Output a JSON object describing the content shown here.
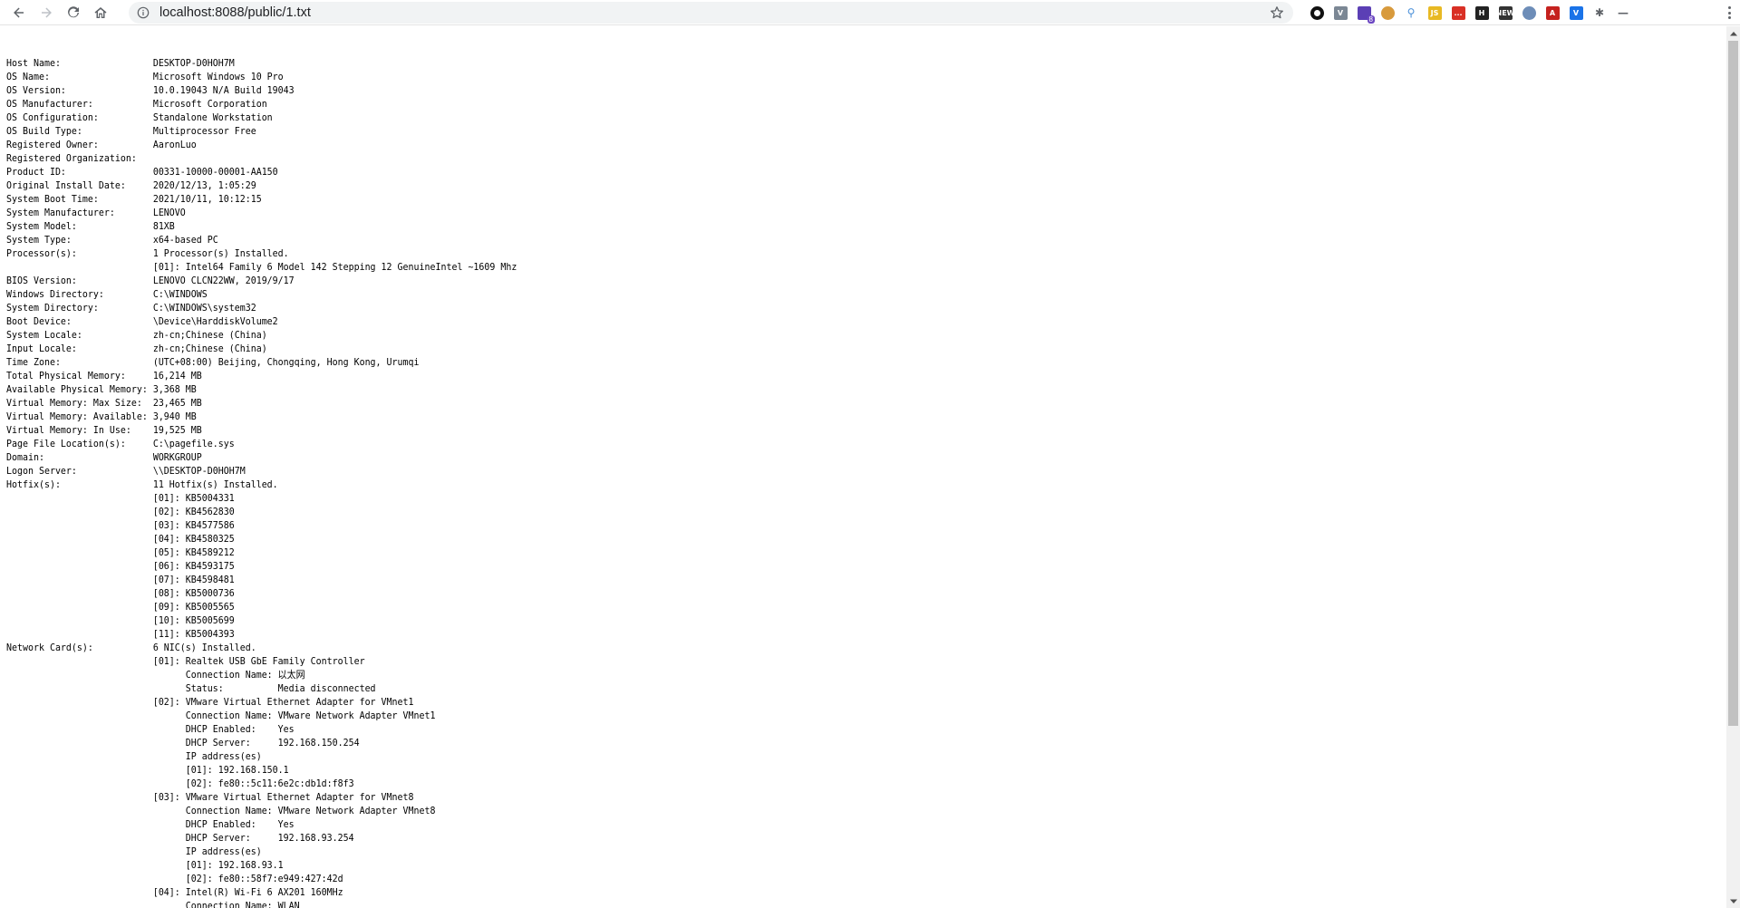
{
  "browser": {
    "url": "localhost:8088/public/1.txt",
    "extensions": [
      {
        "name": "obsidian-icon",
        "color": "#111111",
        "text": ""
      },
      {
        "name": "vue-devtools-icon",
        "color": "#7b8794",
        "text": "V"
      },
      {
        "name": "stack-icon",
        "color": "#5b3fb5",
        "text": "",
        "badge": "8"
      },
      {
        "name": "cookie-icon",
        "color": "#d89a3c",
        "text": ""
      },
      {
        "name": "pin-icon",
        "color": "#4a90d9",
        "text": ""
      },
      {
        "name": "js-icon",
        "color": "#e8b923",
        "text": "JS"
      },
      {
        "name": "red-bar-icon",
        "color": "#d93025",
        "text": "..."
      },
      {
        "name": "h-icon",
        "color": "#222222",
        "text": "H"
      },
      {
        "name": "new-icon",
        "color": "#333333",
        "text": "NEW"
      },
      {
        "name": "compass-icon",
        "color": "#6d8db8",
        "text": ""
      },
      {
        "name": "pdf-icon",
        "color": "#c5221f",
        "text": "A"
      },
      {
        "name": "vpn-icon",
        "color": "#1a73e8",
        "text": "V"
      },
      {
        "name": "puzzle-icon",
        "color": "#5f6368",
        "text": ""
      },
      {
        "name": "minus-icon",
        "color": "#5f6368",
        "text": ""
      }
    ]
  },
  "document": {
    "text": "Host Name:                 DESKTOP-D0HOH7M\nOS Name:                   Microsoft Windows 10 Pro\nOS Version:                10.0.19043 N/A Build 19043\nOS Manufacturer:           Microsoft Corporation\nOS Configuration:          Standalone Workstation\nOS Build Type:             Multiprocessor Free\nRegistered Owner:          AaronLuo\nRegistered Organization:\nProduct ID:                00331-10000-00001-AA150\nOriginal Install Date:     2020/12/13, 1:05:29\nSystem Boot Time:          2021/10/11, 10:12:15\nSystem Manufacturer:       LENOVO\nSystem Model:              81XB\nSystem Type:               x64-based PC\nProcessor(s):              1 Processor(s) Installed.\n                           [01]: Intel64 Family 6 Model 142 Stepping 12 GenuineIntel ~1609 Mhz\nBIOS Version:              LENOVO CLCN22WW, 2019/9/17\nWindows Directory:         C:\\WINDOWS\nSystem Directory:          C:\\WINDOWS\\system32\nBoot Device:               \\Device\\HarddiskVolume2\nSystem Locale:             zh-cn;Chinese (China)\nInput Locale:              zh-cn;Chinese (China)\nTime Zone:                 (UTC+08:00) Beijing, Chongqing, Hong Kong, Urumqi\nTotal Physical Memory:     16,214 MB\nAvailable Physical Memory: 3,368 MB\nVirtual Memory: Max Size:  23,465 MB\nVirtual Memory: Available: 3,940 MB\nVirtual Memory: In Use:    19,525 MB\nPage File Location(s):     C:\\pagefile.sys\nDomain:                    WORKGROUP\nLogon Server:              \\\\DESKTOP-D0HOH7M\nHotfix(s):                 11 Hotfix(s) Installed.\n                           [01]: KB5004331\n                           [02]: KB4562830\n                           [03]: KB4577586\n                           [04]: KB4580325\n                           [05]: KB4589212\n                           [06]: KB4593175\n                           [07]: KB4598481\n                           [08]: KB5000736\n                           [09]: KB5005565\n                           [10]: KB5005699\n                           [11]: KB5004393\nNetwork Card(s):           6 NIC(s) Installed.\n                           [01]: Realtek USB GbE Family Controller\n                                 Connection Name: 以太网\n                                 Status:          Media disconnected\n                           [02]: VMware Virtual Ethernet Adapter for VMnet1\n                                 Connection Name: VMware Network Adapter VMnet1\n                                 DHCP Enabled:    Yes\n                                 DHCP Server:     192.168.150.254\n                                 IP address(es)\n                                 [01]: 192.168.150.1\n                                 [02]: fe80::5c11:6e2c:db1d:f8f3\n                           [03]: VMware Virtual Ethernet Adapter for VMnet8\n                                 Connection Name: VMware Network Adapter VMnet8\n                                 DHCP Enabled:    Yes\n                                 DHCP Server:     192.168.93.254\n                                 IP address(es)\n                                 [01]: 192.168.93.1\n                                 [02]: fe80::58f7:e949:427:42d\n                           [04]: Intel(R) Wi-Fi 6 AX201 160MHz\n                                 Connection Name: WLAN"
  }
}
